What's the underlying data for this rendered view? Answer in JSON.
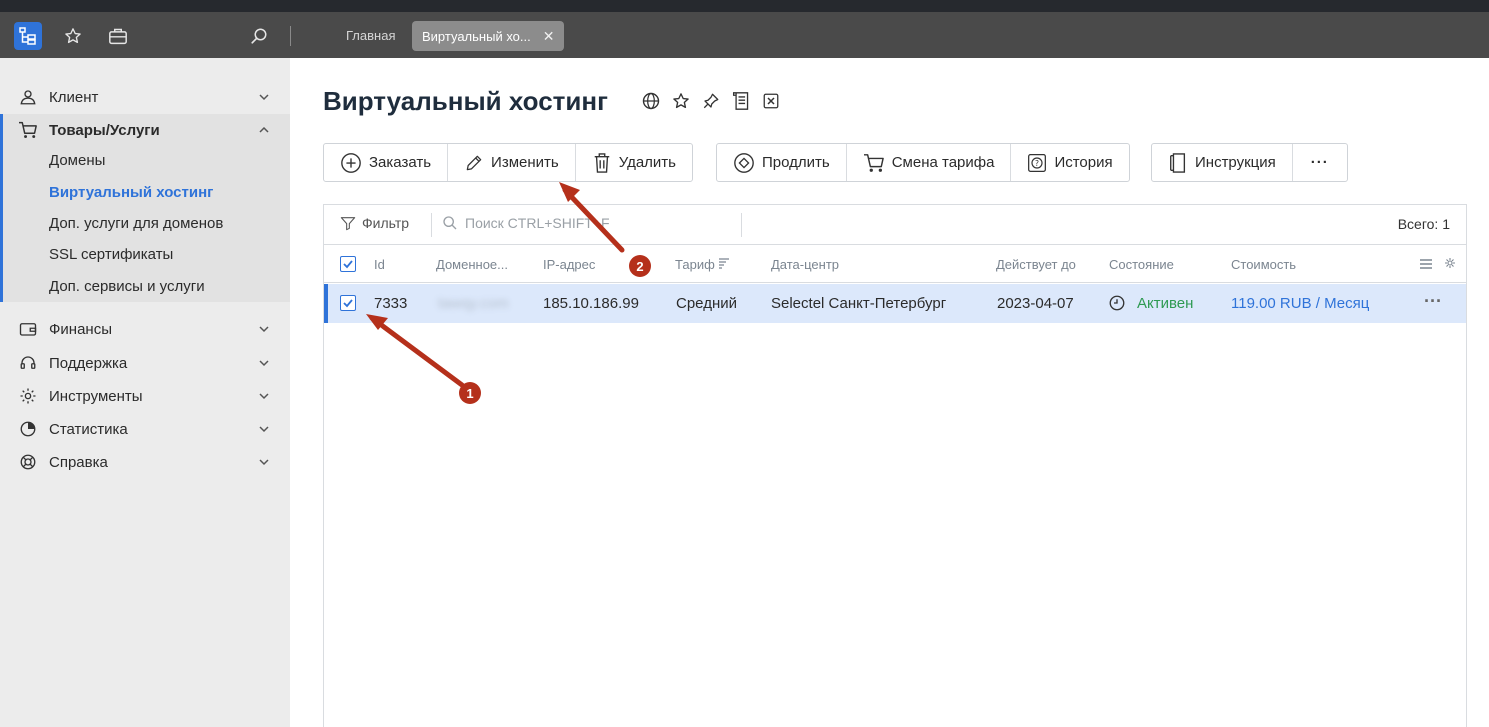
{
  "appbar": {
    "tabs": [
      {
        "label": "Главная"
      },
      {
        "label": "Виртуальный хо..."
      }
    ]
  },
  "sidebar": {
    "items": [
      {
        "label": "Клиент",
        "icon": "user-icon"
      },
      {
        "label": "Товары/Услуги",
        "icon": "cart-icon"
      },
      {
        "label": "Финансы",
        "icon": "wallet-icon"
      },
      {
        "label": "Поддержка",
        "icon": "headset-icon"
      },
      {
        "label": "Инструменты",
        "icon": "gear-icon"
      },
      {
        "label": "Статистика",
        "icon": "pie-chart-icon"
      },
      {
        "label": "Справка",
        "icon": "lifebuoy-icon"
      }
    ],
    "subitems": [
      {
        "label": "Домены"
      },
      {
        "label": "Виртуальный хостинг"
      },
      {
        "label": "Доп. услуги для доменов"
      },
      {
        "label": "SSL сертификаты"
      },
      {
        "label": "Доп. сервисы и услуги"
      }
    ]
  },
  "main": {
    "title": "Виртуальный хостинг",
    "buttons": {
      "order": "Заказать",
      "edit": "Изменить",
      "delete": "Удалить",
      "renew": "Продлить",
      "change_tariff": "Смена тарифа",
      "history": "История",
      "instruction": "Инструкция",
      "more": "···"
    },
    "toolbar": {
      "filter": "Фильтр",
      "search_placeholder": "Поиск CTRL+SHIFT+F",
      "total": "Всего: 1"
    },
    "columns": [
      "Id",
      "Доменное...",
      "IP-адрес",
      "Тариф",
      "Дата-центр",
      "Действует до",
      "Состояние",
      "Стоимость"
    ],
    "rows": [
      {
        "id": "7333",
        "domain": "tawqy.com",
        "ip": "185.10.186.99",
        "tariff": "Средний",
        "datacenter": "Selectel Санкт-Петербург",
        "valid_until": "2023-04-07",
        "status": "Активен",
        "price": "119.00 RUB / Месяц"
      }
    ]
  },
  "annotations": {
    "badge1": "1",
    "badge2": "2"
  },
  "colors": {
    "accent": "#2f73d9",
    "active_status": "#2e9a52",
    "annotation": "#b5301b"
  }
}
